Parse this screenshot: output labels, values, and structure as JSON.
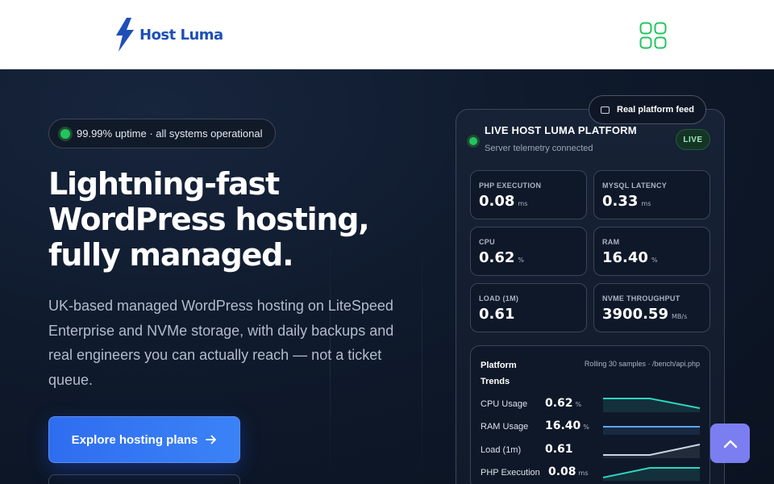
{
  "header": {
    "brand": "Host Luma",
    "logo_icon": "lightning-bolt-icon",
    "menu_icon": "app-grid-icon",
    "brand_color": "#1e4fb8",
    "menu_color": "#22c55e"
  },
  "hero": {
    "status_pill": "99.99% uptime · all systems operational",
    "headline": [
      "Lightning-fast",
      "WordPress hosting,",
      "fully managed."
    ],
    "subtext": "UK-based managed WordPress hosting on LiteSpeed Enterprise and NVMe storage, with daily backups and real engineers you can actually reach — not a ticket queue.",
    "cta_label": "Explore hosting plans",
    "cta_icon": "arrow-right-icon",
    "accent": "#3b82f6"
  },
  "platform": {
    "feed_label": "Real platform feed",
    "title": "LIVE HOST LUMA PLATFORM",
    "subtitle": "Server telemetry connected",
    "live_badge": "LIVE",
    "metrics": [
      {
        "label": "PHP EXECUTION",
        "value": "0.08",
        "unit": "ms"
      },
      {
        "label": "MYSQL LATENCY",
        "value": "0.33",
        "unit": "ms"
      },
      {
        "label": "CPU",
        "value": "0.62",
        "unit": "%"
      },
      {
        "label": "RAM",
        "value": "16.40",
        "unit": "%"
      },
      {
        "label": "LOAD (1M)",
        "value": "0.61",
        "unit": ""
      },
      {
        "label": "NVME THROUGHPUT",
        "value": "3900.59",
        "unit": "MB/s"
      }
    ],
    "trends": {
      "title": "Platform Trends",
      "meta": "Rolling 30 samples · /bench/api.php",
      "rows": [
        {
          "name": "CPU Usage",
          "value": "0.62",
          "unit": "%",
          "color": "#2dd4bf",
          "trend": "down"
        },
        {
          "name": "RAM Usage",
          "value": "16.40",
          "unit": "%",
          "color": "#60a5fa",
          "trend": "flat"
        },
        {
          "name": "Load (1m)",
          "value": "0.61",
          "unit": "",
          "color": "#cbd5e1",
          "trend": "up"
        },
        {
          "name": "PHP Execution",
          "value": "0.08",
          "unit": "ms",
          "color": "#2dd4bf",
          "trend": "up"
        }
      ]
    }
  },
  "scroll_top_icon": "chevron-up-icon",
  "scroll_top_color": "#7b7ef0"
}
